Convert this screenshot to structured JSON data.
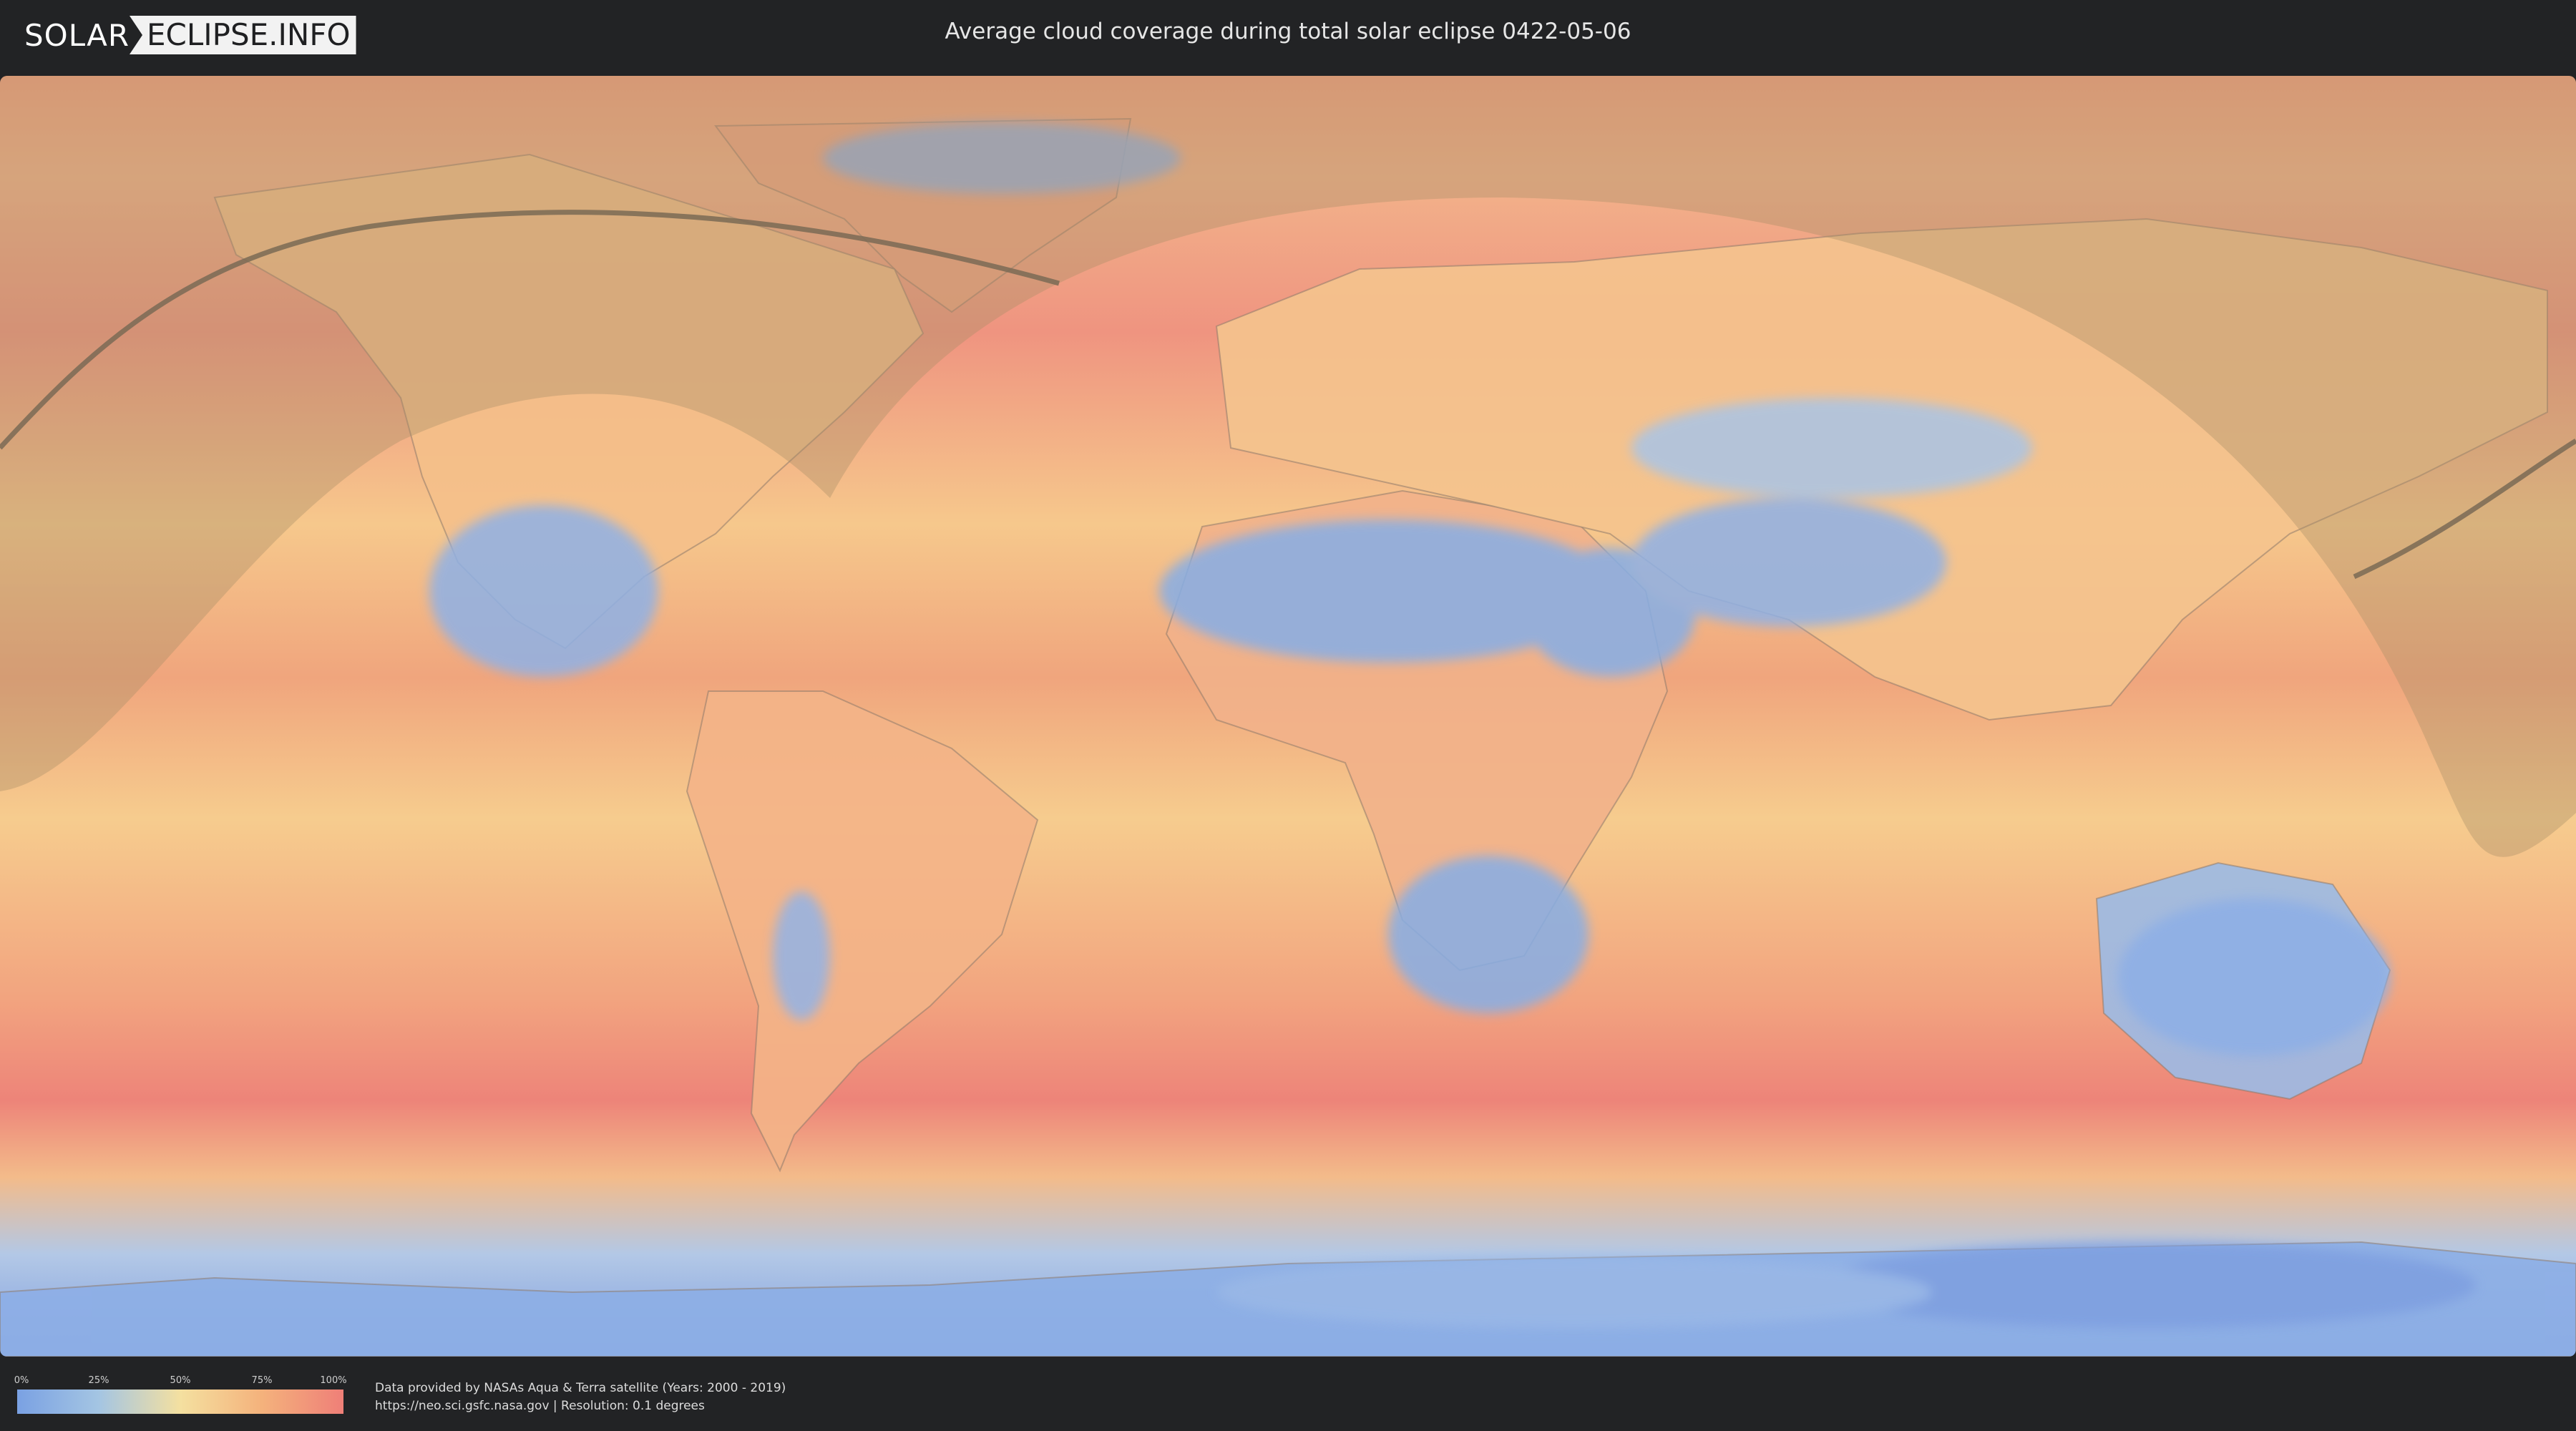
{
  "header": {
    "logo_part1": "SOLAR",
    "logo_part2": "ECLIPSE.INFO",
    "title": "Average cloud coverage during total solar eclipse 0422-05-06"
  },
  "map": {
    "description_icon": "world-cloud-coverage-map",
    "colors": {
      "ocean_cloudy": "#ef8a7a",
      "mid": "#f6cd8e",
      "clear": "#86aee6",
      "night_shade": "#b79a72",
      "eclipse_path": "#7a6a55"
    }
  },
  "legend": {
    "ticks": [
      "0%",
      "25%",
      "50%",
      "75%",
      "100%"
    ],
    "gradient": [
      "#7aa1e3",
      "#a4c5e3",
      "#f4e0a0",
      "#f4b27c",
      "#ef7f78"
    ]
  },
  "credits": {
    "line1": "Data provided by NASAs Aqua & Terra satellite (Years: 2000 - 2019)",
    "line2": "https://neo.sci.gsfc.nasa.gov | Resolution: 0.1 degrees"
  }
}
